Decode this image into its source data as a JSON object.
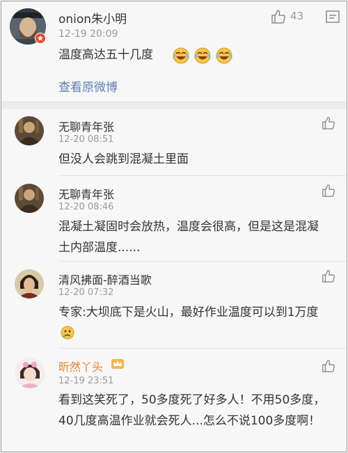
{
  "main": {
    "username": "onion朱小明",
    "time": "12-19 20:09",
    "text": "温度高达五十几度",
    "link": "查看原微博",
    "like_count": "43"
  },
  "replies": [
    {
      "name": "无聊青年张",
      "time": "12-20 08:51",
      "text": "但没人会跳到混凝土里面"
    },
    {
      "name": "无聊青年张",
      "time": "12-20 08:46",
      "text": "混凝土凝固时会放热，温度会很高，但是这是混凝土内部温度......"
    },
    {
      "name": "清风拂面-醉酒当歌",
      "time": "12-20 07:32",
      "text": "专家:大坝底下是火山，最好作业温度可以到1万度"
    },
    {
      "name": "昕然丫头",
      "time": "12-19 23:51",
      "text": "看到这笑死了，50多度死了好多人！不用50多度，40几度高温作业就会死人...怎么不说100多度啊！"
    }
  ],
  "colors": {
    "accent_link": "#5b7fb3",
    "orange_name": "#e8812c",
    "badge_red": "#e8492f"
  },
  "icons": [
    "thumbs-up-icon",
    "message-icon",
    "laughing-emoji",
    "crying-emoji",
    "verified-badge",
    "vip-crown-icon"
  ]
}
